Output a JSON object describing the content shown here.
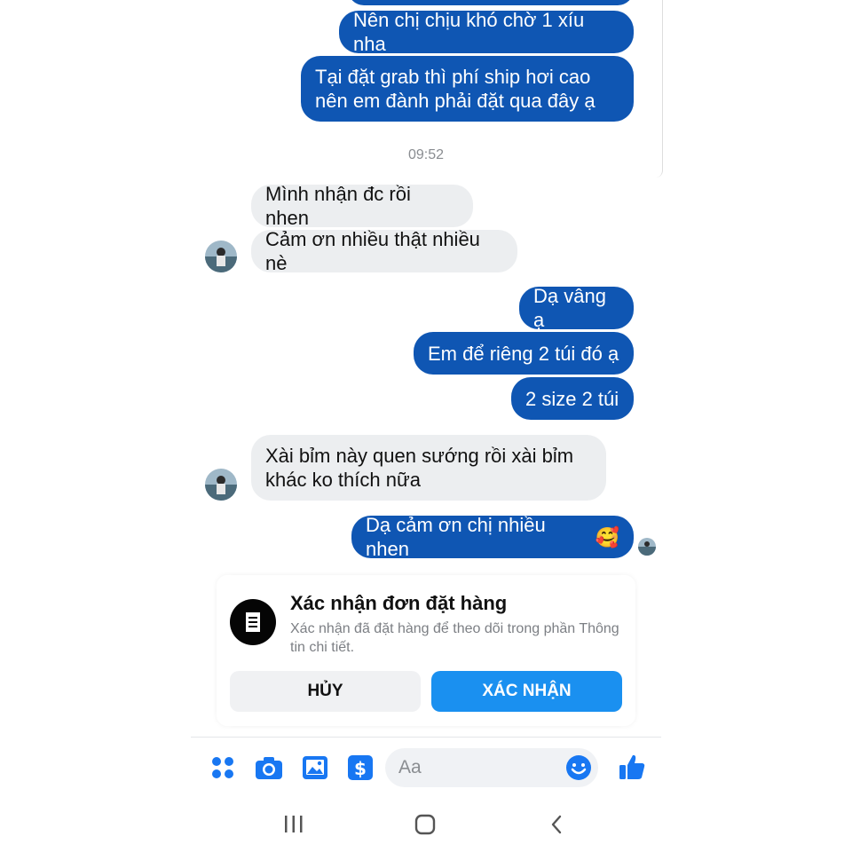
{
  "messages": {
    "out_1": "Nên chị chịu khó chờ 1 xíu nha",
    "out_2_line1": "Tại đặt grab thì phí ship hơi cao",
    "out_2_line2": "nên em đành phải đặt qua đây ạ",
    "timestamp": "09:52",
    "in_1": "Mình nhận đc rồi nhen",
    "in_2": "Cảm ơn nhiều thật nhiều nè",
    "out_3": "Dạ vâng ạ",
    "out_4": "Em để riêng 2 túi đó ạ",
    "out_5": "2 size 2 túi",
    "in_3_line1": "Xài bỉm này quen sướng rồi xài bỉm",
    "in_3_line2": "khác ko thích nữa",
    "out_6": "Dạ cảm ơn chị nhiều nhen",
    "out_6_emoji": "🥰"
  },
  "order_card": {
    "title": "Xác nhận đơn đặt hàng",
    "description": "Xác nhận đã đặt hàng để theo dõi trong phần Thông tin chi tiết.",
    "cancel_label": "HỦY",
    "confirm_label": "XÁC NHẬN",
    "icon": "receipt-icon"
  },
  "composer": {
    "placeholder": "Aa",
    "icons": [
      "menu-dots-icon",
      "camera-icon",
      "image-icon",
      "payment-icon",
      "emoji-icon",
      "like-icon"
    ]
  },
  "navbar": {
    "icons": [
      "recent-apps-icon",
      "home-icon",
      "back-icon"
    ]
  },
  "colors": {
    "outgoing_bubble": "#0f56b3",
    "incoming_bubble": "#eceef0",
    "accent": "#1a90f0"
  }
}
